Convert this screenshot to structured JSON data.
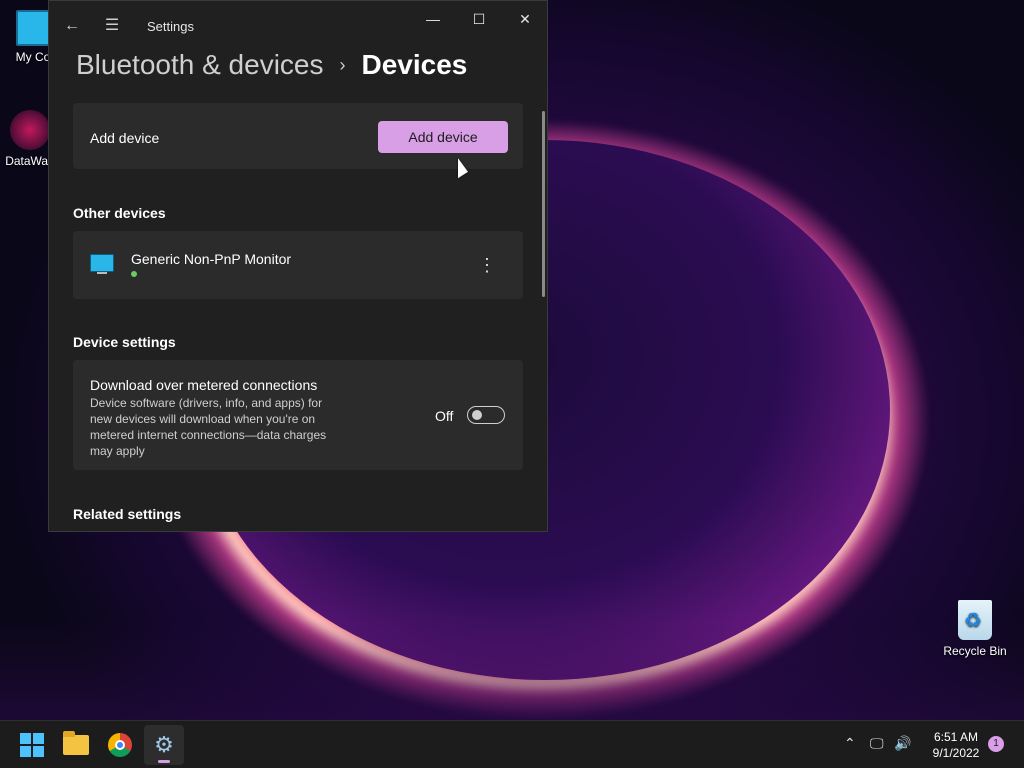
{
  "desktop": {
    "icons": [
      {
        "label": "My Com"
      },
      {
        "label": "DataWag"
      },
      {
        "label": "Recycle Bin"
      }
    ]
  },
  "window": {
    "app_title": "Settings",
    "controls": {
      "minimize": "—",
      "maximize": "☐",
      "close": "✕"
    },
    "back_glyph": "←",
    "menu_glyph": "☰"
  },
  "breadcrumb": {
    "parent": "Bluetooth & devices",
    "separator": "›",
    "current": "Devices"
  },
  "add_device": {
    "label": "Add device",
    "button": "Add device"
  },
  "other_devices": {
    "title": "Other devices",
    "items": [
      {
        "name": "Generic Non-PnP Monitor",
        "status_color": "#6ccb5f",
        "icon": "monitor-icon",
        "more": "⋮"
      }
    ]
  },
  "device_settings": {
    "title": "Device settings",
    "metered": {
      "title": "Download over metered connections",
      "description": "Device software (drivers, info, and apps) for new devices will download when you're on metered internet connections—data charges may apply",
      "toggle_label": "Off",
      "enabled": false
    }
  },
  "related_settings": {
    "title": "Related settings"
  },
  "taskbar": {
    "apps": [
      "start",
      "file-explorer",
      "chrome",
      "settings"
    ],
    "tray": {
      "chevron": "⌃",
      "network": "🖵",
      "volume": "🔊"
    },
    "clock": {
      "time": "6:51 AM",
      "date": "9/1/2022"
    },
    "notifications": "1"
  },
  "colors": {
    "accent": "#d89ee6",
    "window_bg": "#202020",
    "card_bg": "#2b2b2b",
    "taskbar_bg": "#1c1c1c"
  }
}
